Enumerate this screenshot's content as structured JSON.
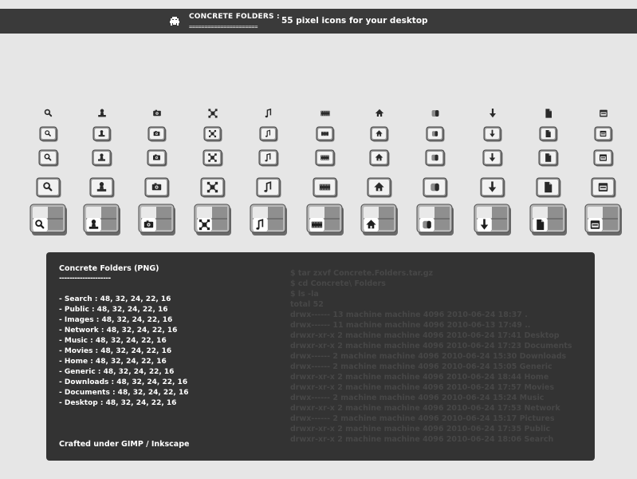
{
  "header": {
    "title": "CONCRETE FOLDERS :",
    "rule": "======================",
    "tagline": "55 pixel icons for your desktop",
    "logo_icon": "space-invader-icon"
  },
  "icon_set": {
    "folders": [
      "search",
      "public",
      "images",
      "network",
      "music",
      "movies",
      "home",
      "generic",
      "downloads",
      "documents",
      "desktop"
    ],
    "sizes": [
      16,
      22,
      24,
      32,
      48
    ]
  },
  "panel": {
    "title": "Concrete Folders (PNG)",
    "dash": "--------------------",
    "items": [
      "- Search : 48, 32, 24, 22, 16",
      "- Public : 48, 32, 24, 22, 16",
      "- Images : 48, 32, 24, 22, 16",
      "- Network : 48, 32, 24, 22, 16",
      "- Music : 48, 32, 24, 22, 16",
      "- Movies : 48, 32, 24, 22, 16",
      "- Home : 48, 32, 24, 22, 16",
      "- Generic : 48, 32, 24, 22, 16",
      "- Downloads : 48, 32, 24, 22, 16",
      "- Documents : 48, 32, 24, 22, 16",
      "- Desktop : 48, 32, 24, 22, 16"
    ],
    "credit": "Crafted under GIMP / Inkscape",
    "terminal": [
      "$ tar zxvf Concrete.Folders.tar.gz",
      "$ cd Concrete\\ Folders",
      "$ ls -la",
      "total 52",
      "drwx------ 13 machine machine 4096 2010-06-24 18:37 .",
      "drwx------ 11 machine machine 4096 2010-06-13 17:49 ..",
      "drwxr-xr-x  2 machine machine 4096 2010-06-24 17:41 Desktop",
      "drwxr-xr-x  2 machine machine 4096 2010-06-24 17:23 Documents",
      "drwx------  2 machine machine 4096 2010-06-24 15:30 Downloads",
      "drwx------  2 machine machine 4096 2010-06-24 15:05 Generic",
      "drwxr-xr-x  2 machine machine 4096 2010-06-24 18:44 Home",
      "drwxr-xr-x  2 machine machine 4096 2010-06-24 17:57 Movies",
      "drwx------  2 machine machine 4096 2010-06-24 15:24 Music",
      "drwxr-xr-x  2 machine machine 4096 2010-06-24 17:53 Network",
      "drwx------  2 machine machine 4096 2010-06-24 15:17 Pictures",
      "drwxr-xr-x  2 machine machine 4096 2010-06-24 17:35 Public",
      "drwxr-xr-x  2 machine machine 4096 2010-06-24 18:06 Search"
    ]
  }
}
